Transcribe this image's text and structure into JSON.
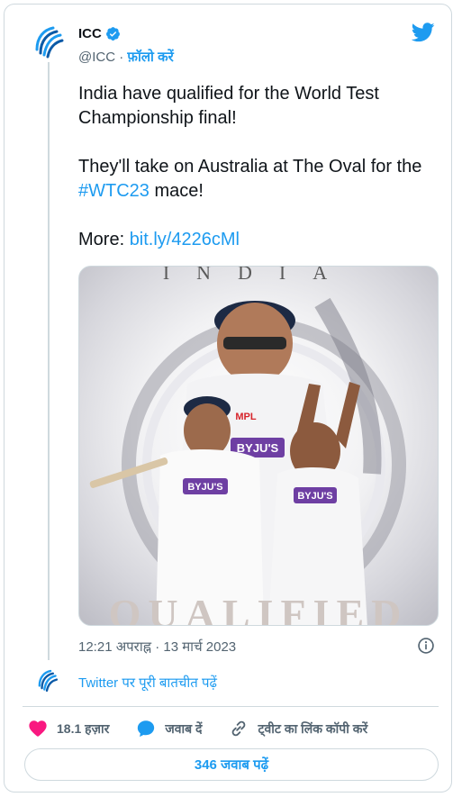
{
  "account": {
    "name": "ICC",
    "handle": "@ICC",
    "separator": "·",
    "follow_label": "फ़ॉलो करें"
  },
  "tweet": {
    "line1": "India have qualified for the World Test Championship final!",
    "line2_prefix": "They'll take on Australia at The Oval for the ",
    "hashtag": "#WTC23",
    "line2_suffix": " mace!",
    "more_label": "More: ",
    "link": "bit.ly/4226cMl"
  },
  "media": {
    "top_text": "INDIA",
    "bottom_text": "QUALIFIED",
    "jersey_text": "BYJU'S",
    "badge_text": "MPL"
  },
  "timestamp": "12:21 अपराह्न · 13 मार्च 2023",
  "conversation_link": "Twitter पर पूरी बातचीत पढ़ें",
  "actions": {
    "likes": "18.1 हज़ार",
    "reply_label": "जवाब दें",
    "copy_link_label": "ट्वीट का लिंक कॉपी करें"
  },
  "more_replies": "346 जवाब पढ़ें",
  "colors": {
    "accent": "#1d9bf0",
    "like": "#f91880",
    "text": "#0f1419",
    "muted": "#536471",
    "border": "#cfd9de"
  },
  "icons": [
    "icc-logo-icon",
    "verified-badge-icon",
    "twitter-bird-icon",
    "info-icon",
    "heart-icon",
    "reply-bubble-icon",
    "link-icon"
  ]
}
